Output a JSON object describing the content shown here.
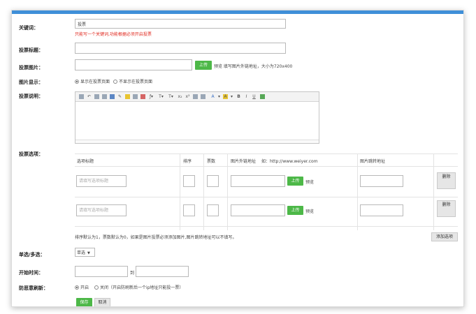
{
  "keyword": {
    "label": "关键词：",
    "value": "投票",
    "hint": "只能写一个关键词,功能根据必须开启投票"
  },
  "title_row": {
    "label": "投票标题："
  },
  "image_row": {
    "label": "投票图片：",
    "upload": "上传",
    "hint": "预览 填写图片外链地址，大小为720x400"
  },
  "display_row": {
    "label": "图片显示：",
    "option_show": "显示在投票页面",
    "option_hide": "不显示在投票页面"
  },
  "desc_row": {
    "label": "投票说明："
  },
  "options": {
    "label": "投票选项：",
    "headers": {
      "title": "选项标题",
      "sort": "排序",
      "count": "票数",
      "link": "图片外链地址",
      "link_example": "如：http://www.weiyer.com",
      "jump": "图片跳转地址"
    },
    "rows": [
      {
        "placeholder": "请填写选项标题",
        "upload": "上传",
        "preview": "预览",
        "delete": "删除"
      },
      {
        "placeholder": "请填写选项标题",
        "upload": "上传",
        "preview": "预览",
        "delete": "删除"
      }
    ],
    "note": "排序默认为1，票数默认为0，如果是图片投票必须添加图片,图片跳转地址可以不填写。",
    "add": "添加选项"
  },
  "select_row": {
    "label": "单选/多选：",
    "value": "单选"
  },
  "time_row": {
    "label": "开始时间：",
    "to": "到"
  },
  "refresh_row": {
    "label": "防恶意刷新：",
    "on": "开启",
    "off": "关闭（开启防刷新后一个ip地址只能投一票）"
  },
  "actions": {
    "save": "保存",
    "cancel": "取消"
  }
}
